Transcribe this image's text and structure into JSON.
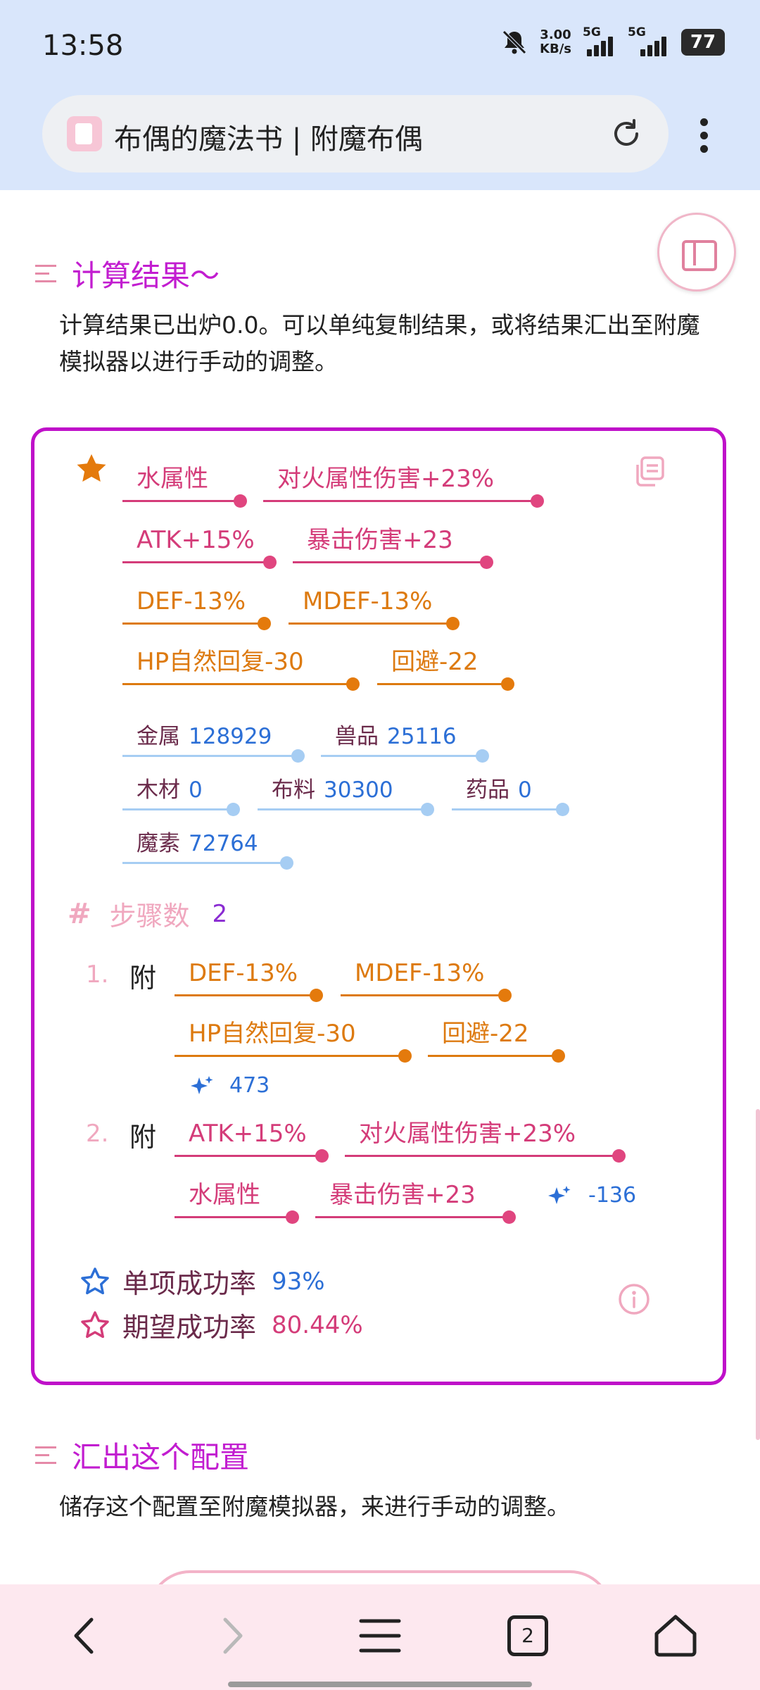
{
  "status": {
    "time": "13:58",
    "net_speed_top": "3.00",
    "net_speed_unit": "KB/s",
    "sim1": "5G",
    "sim2": "5G",
    "battery": "77"
  },
  "browser": {
    "page_title": "布偶的魔法书 | 附魔布偶",
    "tab_count": "2"
  },
  "section1": {
    "title": "计算结果～",
    "description": "计算结果已出炉0.0。可以单纯复制结果，或将结果汇出至附魔模拟器以进行手动的调整。"
  },
  "result": {
    "attributes": [
      "水属性",
      "对火属性伤害+23%",
      "ATK+15%",
      "暴击伤害+23",
      "DEF-13%",
      "MDEF-13%",
      "HP自然回复-30",
      "回避-22"
    ],
    "materials": [
      {
        "name": "金属",
        "value": "128929"
      },
      {
        "name": "兽品",
        "value": "25116"
      },
      {
        "name": "木材",
        "value": "0"
      },
      {
        "name": "布料",
        "value": "30300"
      },
      {
        "name": "药品",
        "value": "0"
      },
      {
        "name": "魔素",
        "value": "72764"
      }
    ],
    "steps_label": "步骤数",
    "steps_count": "2",
    "steps": [
      {
        "num": "1.",
        "action": "附",
        "items": [
          "DEF-13%",
          "MDEF-13%",
          "HP自然回复-30",
          "回避-22"
        ],
        "cost": "473"
      },
      {
        "num": "2.",
        "action": "附",
        "items": [
          "ATK+15%",
          "对火属性伤害+23%",
          "水属性",
          "暴击伤害+23"
        ],
        "cost": "-136"
      }
    ],
    "single_rate_label": "单项成功率",
    "single_rate_value": "93%",
    "expected_rate_label": "期望成功率",
    "expected_rate_value": "80.44%"
  },
  "section2": {
    "title": "汇出这个配置",
    "description": "储存这个配置至附魔模拟器，来进行手动的调整。"
  },
  "icons": {
    "favorite": "star-icon",
    "copy": "copy-icon",
    "info": "info-icon",
    "sparkle": "sparkle-icon"
  },
  "colors": {
    "accent": "#bf10c9",
    "pink": "#d43c79",
    "orange": "#dd7a10",
    "blue": "#2c6fd6"
  }
}
